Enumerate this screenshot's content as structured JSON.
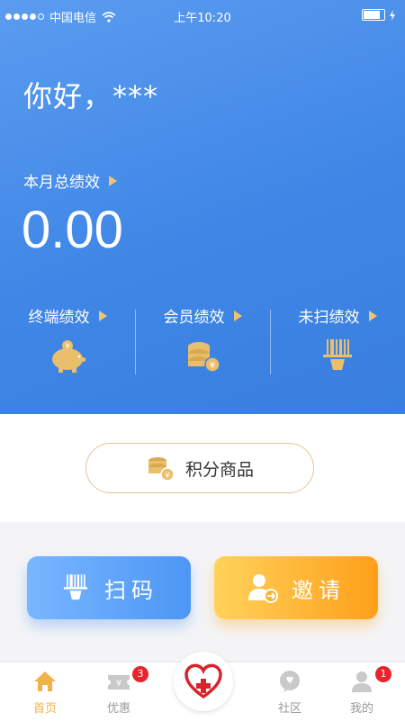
{
  "status": {
    "carrier": "中国电信",
    "time": "上午10:20"
  },
  "greeting": "你好，***",
  "performance": {
    "label": "本月总绩效",
    "total": "0.00"
  },
  "stats": [
    {
      "label": "终端绩效",
      "icon": "piggy-bank-icon"
    },
    {
      "label": "会员绩效",
      "icon": "coins-icon"
    },
    {
      "label": "未扫绩效",
      "icon": "barcode-scanner-icon"
    }
  ],
  "points_button": {
    "label": "积分商品",
    "icon": "coins-icon"
  },
  "actions": {
    "scan": "扫码",
    "invite": "邀请"
  },
  "tabs": [
    {
      "label": "首页",
      "icon": "home-icon",
      "active": true
    },
    {
      "label": "优惠",
      "icon": "ticket-icon",
      "badge": "3"
    },
    {
      "label": "社区",
      "icon": "chat-icon"
    },
    {
      "label": "我的",
      "icon": "user-icon",
      "badge": "1"
    }
  ],
  "center_icon": "heart-plus-icon",
  "colors": {
    "primary_blue": "#3f86e6",
    "accent_gold": "#f0c36d",
    "active_tab": "#f0b34c",
    "invite_orange": "#ff9f1a",
    "badge_red": "#e8232b"
  }
}
